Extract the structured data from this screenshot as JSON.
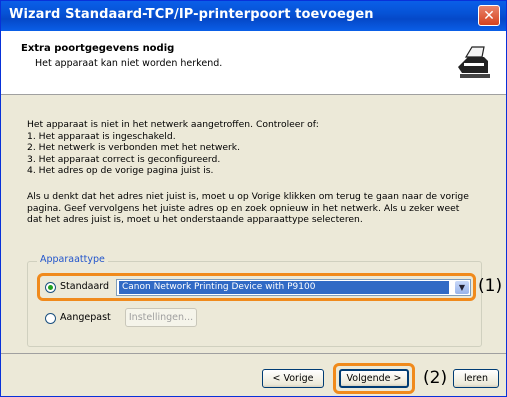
{
  "window": {
    "title": "Wizard Standaard-TCP/IP-printerpoort toevoegen",
    "close_glyph": "✕"
  },
  "header": {
    "title": "Extra poortgegevens nodig",
    "subtitle": "Het apparaat kan niet worden herkend.",
    "icon": "printer-network-icon"
  },
  "body": {
    "lines1": [
      "Het apparaat is niet in het netwerk aangetroffen. Controleer of:",
      "1. Het apparaat is ingeschakeld.",
      "2. Het netwerk is verbonden met het netwerk.",
      "3. Het apparaat correct is geconfigureerd.",
      "4. Het adres op de vorige pagina juist is."
    ],
    "lines2": [
      "Als u denkt dat het adres niet juist is, moet u op Vorige klikken om terug te gaan naar de vorige",
      "pagina. Geef vervolgens het juiste adres op en zoek opnieuw in het netwerk. Als u zeker weet",
      "dat het adres juist is, moet u het onderstaande apparaattype selecteren."
    ]
  },
  "device_type": {
    "group_label": "Apparaattype",
    "standard_label": "Standaard",
    "standard_selected": true,
    "standard_value": "Canon Network Printing Device with P9100",
    "custom_label": "Aangepast",
    "settings_button": "Instellingen..."
  },
  "callouts": {
    "one": "(1)",
    "two": "(2)"
  },
  "footer": {
    "back_button": "< Vorige",
    "next_button": "Volgende >",
    "cancel_partial": "leren"
  },
  "colors": {
    "highlight": "#f08a1c",
    "titlebar": "#0a5fe8",
    "selection": "#316ac5"
  }
}
